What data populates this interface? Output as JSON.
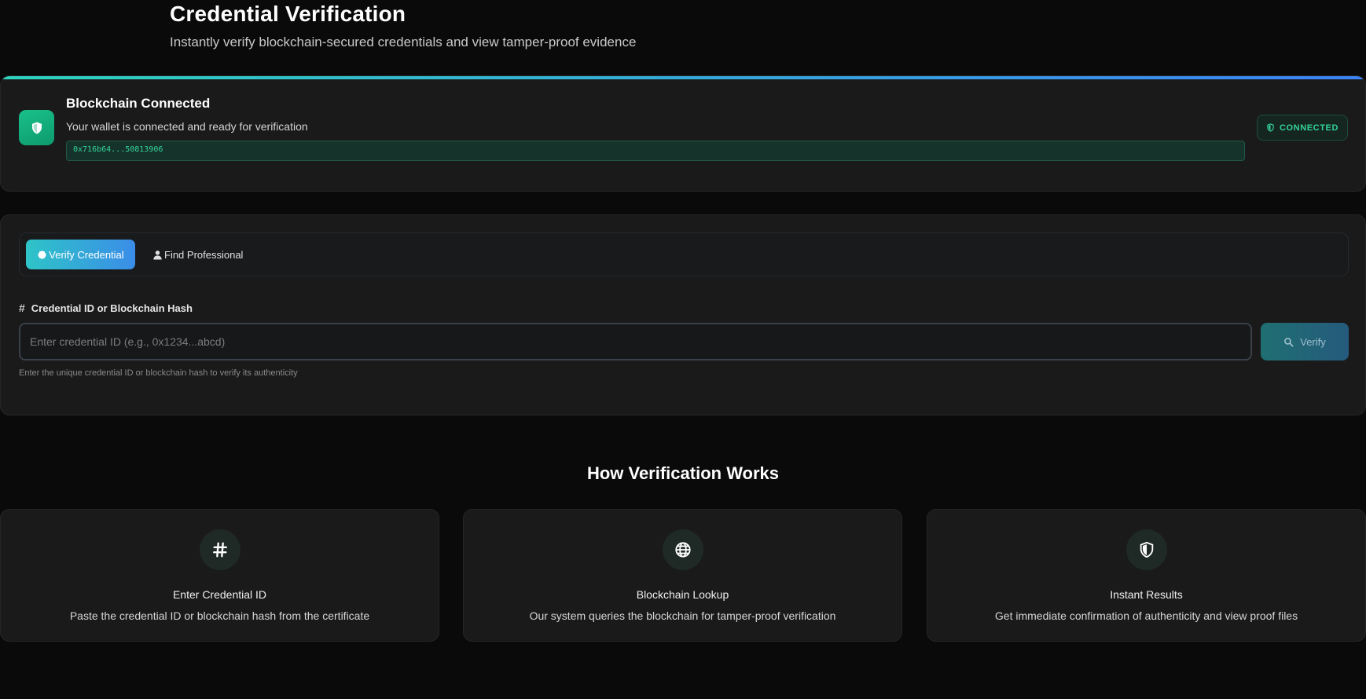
{
  "header": {
    "title": "Credential Verification",
    "subtitle": "Instantly verify blockchain-secured credentials and view tamper-proof evidence"
  },
  "wallet": {
    "title": "Blockchain Connected",
    "description": "Your wallet is connected and ready for verification",
    "address": "0x716b64...50813906",
    "status_badge": "CONNECTED",
    "icon": "shield-icon",
    "status_color": "#34d399"
  },
  "verify": {
    "tabs": [
      {
        "label": "Verify Credential",
        "icon": "badge-icon",
        "active": true
      },
      {
        "label": "Find Professional",
        "icon": "user-icon",
        "active": false
      }
    ],
    "field_label": "Credential ID or Blockchain Hash",
    "input_placeholder": "Enter credential ID (e.g., 0x1234...abcd)",
    "input_value": "",
    "button_label": "Verify",
    "help_text": "Enter the unique credential ID or blockchain hash to verify its authenticity"
  },
  "how_it_works": {
    "title": "How Verification Works",
    "steps": [
      {
        "icon": "hash-icon",
        "title": "Enter Credential ID",
        "description": "Paste the credential ID or blockchain hash from the certificate"
      },
      {
        "icon": "globe-icon",
        "title": "Blockchain Lookup",
        "description": "Our system queries the blockchain for tamper-proof verification"
      },
      {
        "icon": "shield-icon",
        "title": "Instant Results",
        "description": "Get immediate confirmation of authenticity and view proof files"
      }
    ]
  },
  "colors": {
    "background": "#0a0a0a",
    "card": "#1a1a1a",
    "accent_teal": "#2dd4bf",
    "accent_blue": "#3b82f6",
    "success": "#34d399"
  }
}
